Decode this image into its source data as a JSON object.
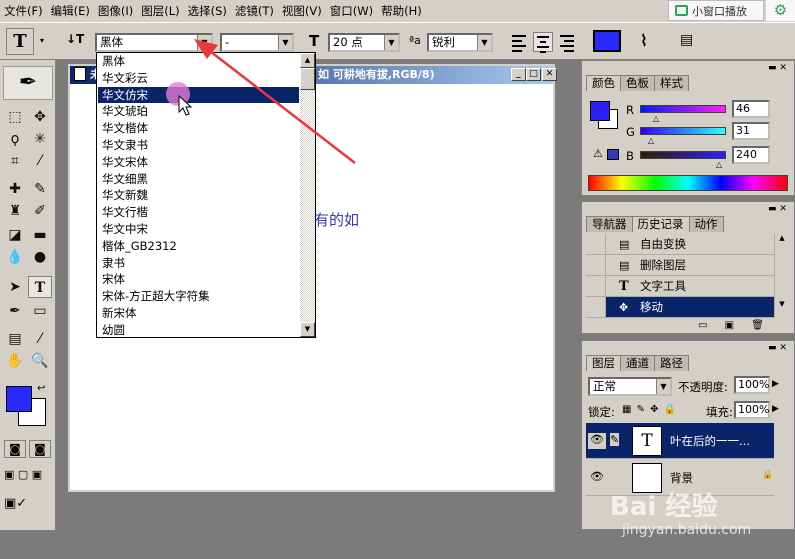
{
  "menu": {
    "items": [
      "文件(F)",
      "编辑(E)",
      "图像(I)",
      "图层(L)",
      "选择(S)",
      "滤镜(T)",
      "视图(V)",
      "窗口(W)",
      "帮助(H)"
    ]
  },
  "overlay": {
    "play_label": "小窗口播放",
    "gear_icon": "gear-icon"
  },
  "options_bar": {
    "tool_glyph": "T",
    "orient_glyph": "↓T",
    "font_family": "黑体",
    "font_style": "-",
    "size_glyph": "T",
    "font_size": "20 点",
    "aa_glyph": "ªa",
    "anti_alias": "锐利",
    "text_color": "#2a2aff"
  },
  "font_list": {
    "items": [
      "黑体",
      "华文彩云",
      "华文仿宋",
      "华文琥珀",
      "华文楷体",
      "华文隶书",
      "华文宋体",
      "华文细黑",
      "华文新魏",
      "华文行楷",
      "华文中宋",
      "楷体_GB2312",
      "隶书",
      "宋体",
      "宋体-方正超大字符集",
      "新宋体",
      "幼圆"
    ],
    "selected": "华文仿宋"
  },
  "document": {
    "title_left": "未",
    "title_right": "如 可耕地有拔,RGB/8)",
    "canvas_text": "有的如"
  },
  "color_panel": {
    "tabs": [
      "颜色",
      "色板",
      "样式"
    ],
    "r_label": "R",
    "g_label": "G",
    "b_label": "B",
    "r": 46,
    "g": 31,
    "b": 240,
    "fg_color": "#2e1ff0"
  },
  "history_panel": {
    "tabs": [
      "导航器",
      "历史记录",
      "动作"
    ],
    "items": [
      {
        "icon": "▤",
        "label": "自由变换"
      },
      {
        "icon": "▤",
        "label": "删除图层"
      },
      {
        "icon": "T",
        "label": "文字工具"
      },
      {
        "icon": "✥",
        "label": "移动"
      }
    ]
  },
  "layers_panel": {
    "tabs": [
      "图层",
      "通道",
      "路径"
    ],
    "blend_mode": "正常",
    "opacity_label": "不透明度:",
    "opacity": "100%",
    "lock_label": "锁定:",
    "fill_label": "填充:",
    "fill": "100%",
    "layers": [
      {
        "name": "叶在后的一一...",
        "thumb": "T"
      },
      {
        "name": "背景",
        "thumb": ""
      }
    ]
  },
  "watermark": {
    "brand": "Bai 经验",
    "url": "jingyan.baidu.com"
  }
}
